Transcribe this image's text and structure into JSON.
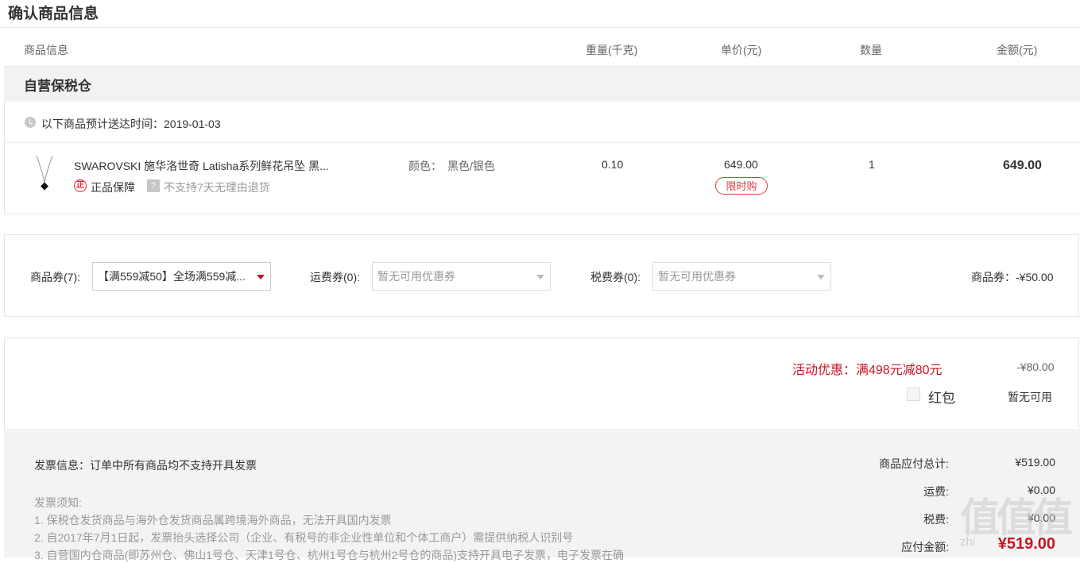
{
  "page": {
    "title": "确认商品信息"
  },
  "columns": {
    "product": "商品信息",
    "weight": "重量(千克)",
    "unit_price": "单价(元)",
    "quantity": "数量",
    "amount": "金额(元)"
  },
  "warehouse": {
    "name": "自营保税仓",
    "delivery_text": "以下商品预计送达时间：2019-01-03"
  },
  "item": {
    "name": "SWAROVSKI 施华洛世奇 Latisha系列鲜花吊坠 黑...",
    "color_label": "颜色：",
    "color_value": "黑色/银色",
    "authentic_icon_glyph": "正",
    "authentic_label": "正品保障",
    "return_icon_glyph": "?",
    "return_label": "不支持7天无理由退货",
    "weight": "0.10",
    "unit_price": "649.00",
    "promo_badge": "限时购",
    "quantity": "1",
    "amount": "649.00"
  },
  "coupons": {
    "goods_label": "商品券(7):",
    "goods_selected": "【满559减50】全场满559减...",
    "shipping_label": "运费券(0):",
    "shipping_placeholder": "暂无可用优惠券",
    "tax_label": "税费券(0):",
    "tax_placeholder": "暂无可用优惠券",
    "summary": "商品券：-¥50.00"
  },
  "promotion": {
    "activity_label": "活动优惠：满498元减80元",
    "activity_value": "-¥80.00",
    "red_packet_label": "红包",
    "red_packet_value": "暂无可用"
  },
  "invoice": {
    "info": "发票信息：订单中所有商品均不支持开具发票",
    "notice_title": "发票须知:",
    "notice_lines": [
      "1. 保税仓发货商品与海外仓发货商品属跨境海外商品，无法开具国内发票",
      "2. 自2017年7月1日起，发票抬头选择公司（企业、有税号的非企业性单位和个体工商户）需提供纳税人识别号",
      "3. 自营国内仓商品(即苏州仓、佛山1号仓、天津1号仓、杭州1号仓与杭州2号仓的商品)支持开具电子发票，电子发票在确"
    ]
  },
  "summary": {
    "goods_total_label": "商品应付总计:",
    "goods_total_value": "¥519.00",
    "shipping_label": "运费:",
    "shipping_value": "¥0.00",
    "tax_label": "税费:",
    "tax_value": "¥0.00",
    "due_label": "应付金额:",
    "due_value": "¥519.00"
  },
  "watermark": {
    "mark": "值值值",
    "sub": "zhi"
  },
  "colors": {
    "accent_red": "#c81623",
    "badge_red": "#e4393c",
    "band_gray": "#f2f2f2"
  },
  "icons": [
    "clock-icon",
    "authentic-icon",
    "question-icon",
    "dropdown-arrow-icon",
    "necklace-thumbnail"
  ]
}
